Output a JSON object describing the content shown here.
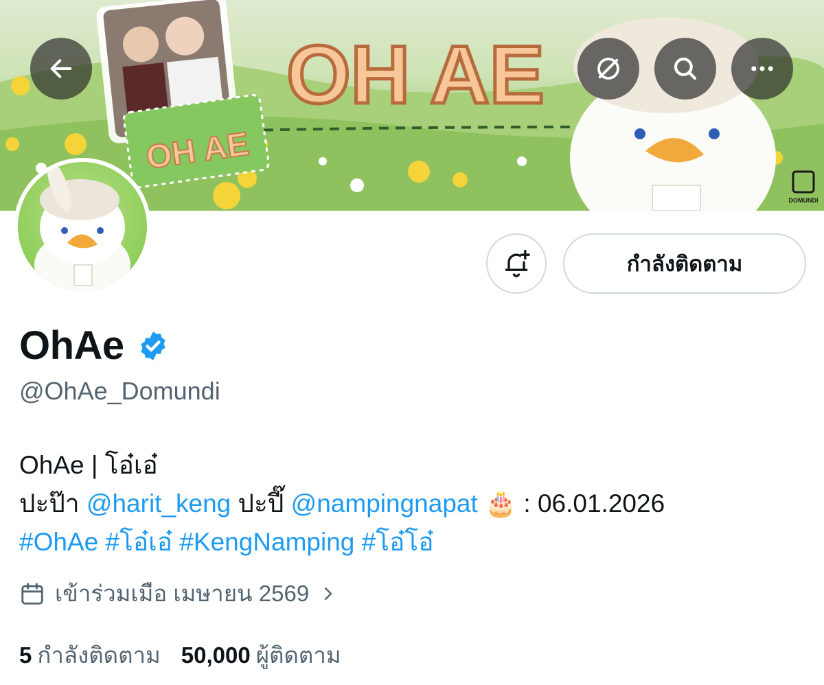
{
  "banner": {
    "title_text": "OH AE",
    "mini_card_text": "OH AE",
    "brand_mark": "DOMUNDI"
  },
  "nav": {
    "back_icon": "arrow-left-icon",
    "hide_icon": "eye-slash-icon",
    "search_icon": "search-icon",
    "more_icon": "more-horizontal-icon"
  },
  "actions": {
    "notify_icon": "bell-plus-icon",
    "follow_label": "กำลังติดตาม"
  },
  "profile": {
    "display_name": "OhAe",
    "verified": true,
    "handle": "@OhAe_Domundi"
  },
  "bio": {
    "line1": "OhAe | โอ๋เอ๋",
    "line2_prefix": "ปะป๊า ",
    "line2_mention1": "@harit_keng",
    "line2_mid": " ปะปี๊ ",
    "line2_mention2": "@nampingnapat",
    "line2_emoji": "🎂",
    "line2_suffix": " : 06.01.2026",
    "hashtags": [
      "#OhAe",
      "#โอ๋เอ๋",
      "#KengNamping",
      "#โอ๋โอ๋"
    ]
  },
  "joined": {
    "icon": "calendar-icon",
    "text": "เข้าร่วมเมือ เมษายน 2569"
  },
  "stats": {
    "following_count": "5",
    "following_label": "กำลังติดตาม",
    "followers_count": "50,000",
    "followers_label": "ผู้ติดตาม"
  },
  "colors": {
    "link": "#1d9bf0",
    "secondary_text": "#536471",
    "verified": "#1d9bf0"
  }
}
